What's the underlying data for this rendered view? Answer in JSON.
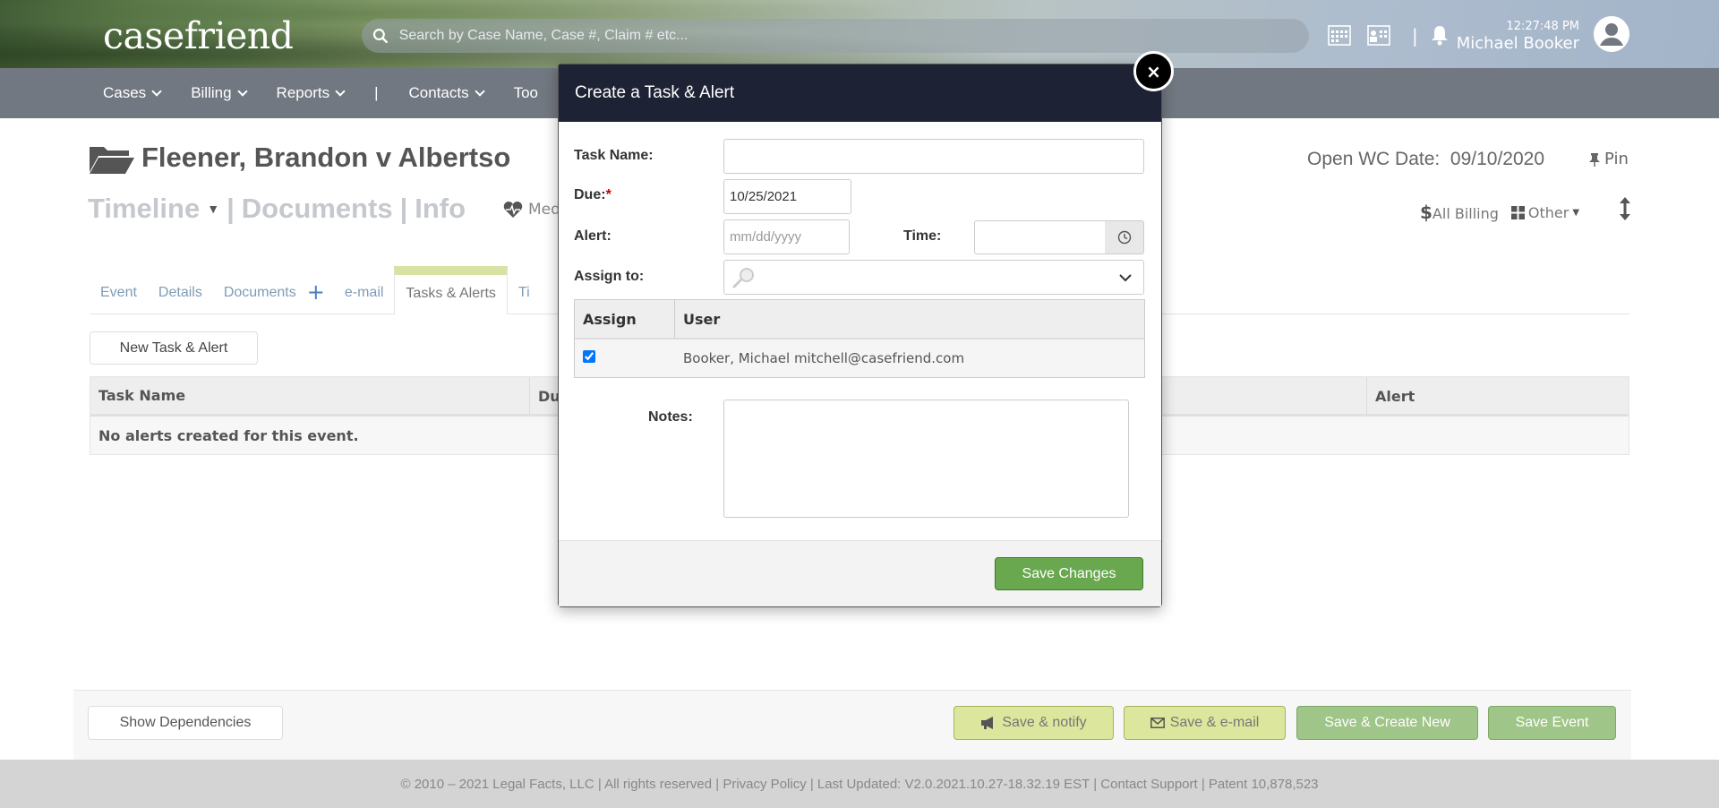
{
  "header": {
    "logo": "casefriend",
    "search_placeholder": "Search by Case Name, Case #, Claim # etc...",
    "time": "12:27:48 PM",
    "user": "Michael Booker",
    "separator": "|"
  },
  "nav": {
    "items": [
      "Cases",
      "Billing",
      "Reports",
      "|",
      "Contacts",
      "Too"
    ]
  },
  "case": {
    "title": "Fleener, Brandon v Albertso",
    "open_wc_label": "Open WC Date:",
    "open_wc_date": "09/10/2020",
    "pin": "Pin",
    "timeline": "Timeline",
    "documents": "Documents",
    "info": "Info",
    "separator": "|",
    "med": "Med",
    "all_billing": "All Billing",
    "other": "Other"
  },
  "tabs": {
    "event": "Event",
    "details": "Details",
    "documents": "Documents",
    "plus": "+",
    "email": "e-mail",
    "tasks": "Tasks & Alerts",
    "ti": "Ti"
  },
  "tasks_panel": {
    "new_button": "New Task & Alert",
    "col_task": "Task Name",
    "col_due": "Du",
    "col_alert": "Alert",
    "empty": "No alerts created for this event."
  },
  "footer_buttons": {
    "show_deps": "Show Dependencies",
    "save_notify": "Save & notify",
    "save_email": "Save & e-mail",
    "save_create": "Save & Create New",
    "save_event": "Save Event"
  },
  "copyright": "© 2010 – 2021 Legal Facts, LLC | All rights reserved | Privacy Policy | Last Updated: V2.0.2021.10.27-18.32.19 EST | Contact Support | Patent 10,878,523",
  "modal": {
    "title": "Create a Task & Alert",
    "close": "×",
    "task_name_label": "Task Name:",
    "task_name_value": "",
    "due_label": "Due:",
    "due_required": "*",
    "due_value": "10/25/2021",
    "alert_label": "Alert:",
    "alert_placeholder": "mm/dd/yyyy",
    "time_label": "Time:",
    "time_value": "",
    "assign_label": "Assign to:",
    "table": {
      "col_assign": "Assign",
      "col_user": "User",
      "rows": [
        {
          "checked": true,
          "user": "Booker, Michael mitchell@casefriend.com"
        }
      ]
    },
    "notes_label": "Notes:",
    "notes_value": "",
    "save_button": "Save Changes"
  },
  "colors": {
    "nav_bg": "#727881",
    "modal_header": "#1e2235",
    "save_green": "#6aa84f",
    "lime_button": "#dde69d",
    "tab_accent": "#d7e3a2"
  }
}
